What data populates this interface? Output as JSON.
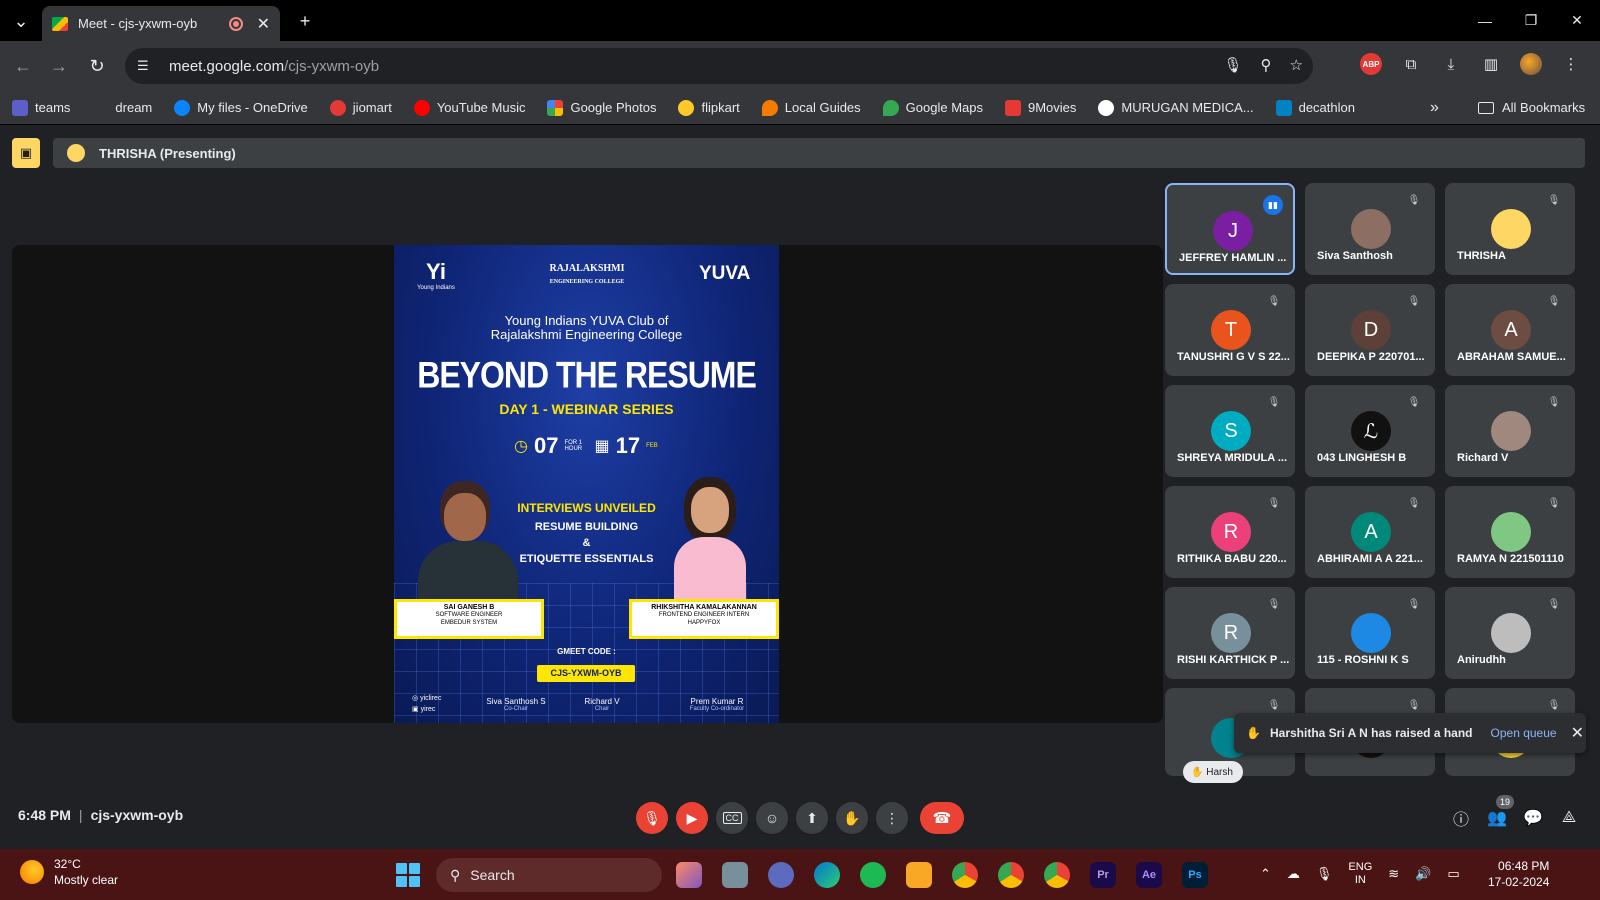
{
  "browser": {
    "tab_title": "Meet - cjs-yxwm-oyb",
    "url_host": "meet.google.com",
    "url_path": "/cjs-yxwm-oyb",
    "bookmarks": [
      {
        "label": "teams",
        "color": "#5b5fc7"
      },
      {
        "label": "dream",
        "color": "#35363a"
      },
      {
        "label": "My files - OneDrive",
        "color": "#0a84ff"
      },
      {
        "label": "jiomart",
        "color": "#e53935"
      },
      {
        "label": "YouTube Music",
        "color": "#ff0000"
      },
      {
        "label": "Google Photos",
        "color": "#fbbc04"
      },
      {
        "label": "flipkart",
        "color": "#2874f0"
      },
      {
        "label": "Local Guides",
        "color": "#f57c00"
      },
      {
        "label": "Google Maps",
        "color": "#34a853"
      },
      {
        "label": "9Movies",
        "color": "#e53935"
      },
      {
        "label": "MURUGAN MEDICA...",
        "color": "#ffffff"
      },
      {
        "label": "decathlon",
        "color": "#0082c3"
      }
    ],
    "all_bookmarks": "All Bookmarks"
  },
  "meet": {
    "presenter_label": "THRISHA (Presenting)",
    "meeting_time": "6:48 PM",
    "meeting_code": "cjs-yxwm-oyb",
    "participant_count": "19",
    "raise_hand_toast": {
      "message": "Harshitha Sri A N has raised a hand",
      "action": "Open queue"
    },
    "hand_chip": "Harsh"
  },
  "poster": {
    "logo_left": "Yi",
    "logo_left_sub": "Young Indians",
    "logo_center": "RAJALAKSHMI",
    "logo_center_sub": "ENGINEERING COLLEGE",
    "logo_right": "YUVA",
    "heading1": "Young Indians YUVA Club of",
    "heading2": "Rajalakshmi Engineering College",
    "title": "BEYOND THE RESUME",
    "subtitle": "DAY 1 - WEBINAR SERIES",
    "time": "07",
    "time_sub": "FOR 1 HOUR",
    "date": "17",
    "date_sub": "FEB",
    "topic1": "INTERVIEWS UNVEILED",
    "topic2": "RESUME BUILDING",
    "topic3": "&",
    "topic4": "ETIQUETTE ESSENTIALS",
    "speaker1_name": "SAI GANESH B",
    "speaker1_role": "SOFTWARE ENGINEER",
    "speaker1_org": "EMBEDUR SYSTEM",
    "speaker2_name": "RHIKSHITHA KAMALAKANNAN",
    "speaker2_role": "FRONTEND ENGINEER INTERN",
    "speaker2_org": "HAPPYFOX",
    "gmeet_label": "GMEET CODE :",
    "gmeet_code": "CJS-YXWM-OYB",
    "social1": "yiclirec",
    "social2": "yirec",
    "sig1_name": "Siva Santhosh S",
    "sig1_role": "Co-Chair",
    "sig2_name": "Richard V",
    "sig2_role": "Chair",
    "sig3_name": "Prem Kumar R",
    "sig3_role": "Faculty Co-ordinator"
  },
  "participants": [
    {
      "name": "JEFFREY HAMLIN ...",
      "initial": "J",
      "color": "#7b1fa2",
      "speaking": true
    },
    {
      "name": "Siva Santhosh",
      "initial": "",
      "color": "#8d6e63",
      "speaking": false
    },
    {
      "name": "THRISHA",
      "initial": "",
      "color": "#fdd663",
      "speaking": false
    },
    {
      "name": "TANUSHRI G V S 22...",
      "initial": "T",
      "color": "#e8541c",
      "speaking": false
    },
    {
      "name": "DEEPIKA P 220701...",
      "initial": "D",
      "color": "#5d4037",
      "speaking": false
    },
    {
      "name": "ABRAHAM SAMUE...",
      "initial": "A",
      "color": "#6d4c41",
      "speaking": false
    },
    {
      "name": "SHREYA MRIDULA ...",
      "initial": "S",
      "color": "#00acc1",
      "speaking": false
    },
    {
      "name": "043 LINGHESH B",
      "initial": "ℒ",
      "color": "#111111",
      "speaking": false
    },
    {
      "name": "Richard V",
      "initial": "",
      "color": "#a1887f",
      "speaking": false
    },
    {
      "name": "RITHIKA BABU 220...",
      "initial": "R",
      "color": "#ec407a",
      "speaking": false
    },
    {
      "name": "ABHIRAMI A A 221...",
      "initial": "A",
      "color": "#00897b",
      "speaking": false
    },
    {
      "name": "RAMYA N 221501110",
      "initial": "",
      "color": "#81c784",
      "speaking": false
    },
    {
      "name": "RISHI KARTHICK P ...",
      "initial": "R",
      "color": "#78909c",
      "speaking": false
    },
    {
      "name": "115 - ROSHNI K S",
      "initial": "",
      "color": "#1e88e5",
      "speaking": false
    },
    {
      "name": "Anirudhh",
      "initial": "",
      "color": "#bdbdbd",
      "speaking": false
    },
    {
      "name": "",
      "initial": "",
      "color": "#00838f",
      "speaking": false
    },
    {
      "name": "",
      "initial": "",
      "color": "#111111",
      "speaking": false
    },
    {
      "name": "",
      "initial": "",
      "color": "#fdd835",
      "speaking": false
    }
  ],
  "taskbar": {
    "temperature": "32°C",
    "weather": "Mostly clear",
    "search_placeholder": "Search",
    "lang1": "ENG",
    "lang2": "IN",
    "time": "06:48 PM",
    "date": "17-02-2024"
  }
}
